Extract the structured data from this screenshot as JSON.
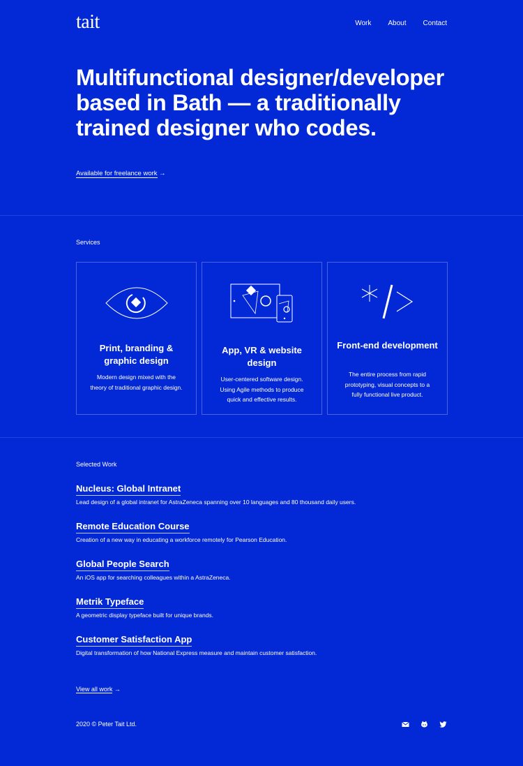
{
  "header": {
    "logo": "tait",
    "nav": [
      "Work",
      "About",
      "Contact"
    ]
  },
  "hero": {
    "headline": "Multifunctional designer/developer based in Bath — a traditionally trained designer who codes.",
    "freelance_link": "Available for freelance work",
    "arrow": "→"
  },
  "services": {
    "label": "Services",
    "cards": [
      {
        "icon": "eye-icon",
        "title": "Print, branding & graphic design",
        "text": "Modern design mixed with the theory of traditional graphic design."
      },
      {
        "icon": "devices-icon",
        "title": "App, VR & website design",
        "text": "User-centered software design. Using Agile methods to produce quick and effective results."
      },
      {
        "icon": "code-icon",
        "title": "Front-end development",
        "text": "The entire process from rapid prototyping, visual concepts to a fully functional live product."
      }
    ]
  },
  "work": {
    "label": "Selected Work",
    "items": [
      {
        "title": "Nucleus: Global Intranet",
        "desc": "Lead design of a global intranet for AstraZeneca spanning over 10 languages and 80 thousand daily users."
      },
      {
        "title": "Remote Education Course",
        "desc": "Creation of a new way in educating a workforce remotely for Pearson Education."
      },
      {
        "title": "Global People Search",
        "desc": "An iOS app for searching colleagues within a AstraZeneca."
      },
      {
        "title": "Metrik Typeface",
        "desc": "A geometric display typeface built for unique brands."
      },
      {
        "title": "Customer Satisfaction App",
        "desc": "Digital transformation of how National Express measure and maintain customer satisfaction."
      }
    ],
    "view_all": "View all work",
    "arrow": "→"
  },
  "footer": {
    "copyright": "2020 © Peter Tait Ltd.",
    "social": [
      "mail-icon",
      "github-icon",
      "twitter-icon"
    ]
  },
  "colors": {
    "background": "#0328d6",
    "text": "#ffffff"
  }
}
